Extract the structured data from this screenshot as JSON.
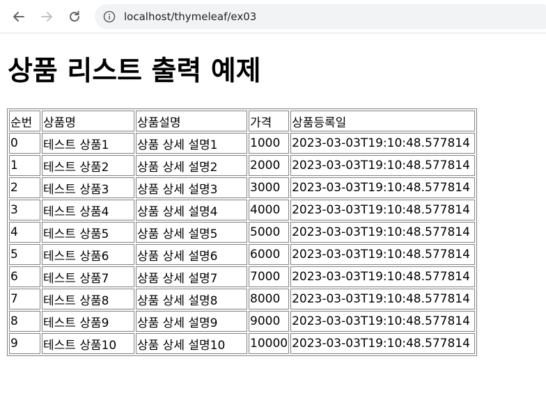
{
  "browser": {
    "url": "localhost/thymeleaf/ex03",
    "back_icon": "arrow-left-icon",
    "forward_icon": "arrow-right-icon",
    "reload_icon": "reload-icon",
    "info_icon": "info-icon"
  },
  "page": {
    "title": "상품 리스트 출력 예제"
  },
  "table": {
    "headers": [
      "순번",
      "상품명",
      "상품설명",
      "가격",
      "상품등록일"
    ],
    "rows": [
      [
        "0",
        "테스트 상품1",
        "상품 상세 설명1",
        "1000",
        "2023-03-03T19:10:48.577814"
      ],
      [
        "1",
        "테스트 상품2",
        "상품 상세 설명2",
        "2000",
        "2023-03-03T19:10:48.577814"
      ],
      [
        "2",
        "테스트 상품3",
        "상품 상세 설명3",
        "3000",
        "2023-03-03T19:10:48.577814"
      ],
      [
        "3",
        "테스트 상품4",
        "상품 상세 설명4",
        "4000",
        "2023-03-03T19:10:48.577814"
      ],
      [
        "4",
        "테스트 상품5",
        "상품 상세 설명5",
        "5000",
        "2023-03-03T19:10:48.577814"
      ],
      [
        "5",
        "테스트 상품6",
        "상품 상세 설명6",
        "6000",
        "2023-03-03T19:10:48.577814"
      ],
      [
        "6",
        "테스트 상품7",
        "상품 상세 설명7",
        "7000",
        "2023-03-03T19:10:48.577814"
      ],
      [
        "7",
        "테스트 상품8",
        "상품 상세 설명8",
        "8000",
        "2023-03-03T19:10:48.577814"
      ],
      [
        "8",
        "테스트 상품9",
        "상품 상세 설명9",
        "9000",
        "2023-03-03T19:10:48.577814"
      ],
      [
        "9",
        "테스트 상품10",
        "상품 상세 설명10",
        "10000",
        "2023-03-03T19:10:48.577814"
      ]
    ]
  }
}
